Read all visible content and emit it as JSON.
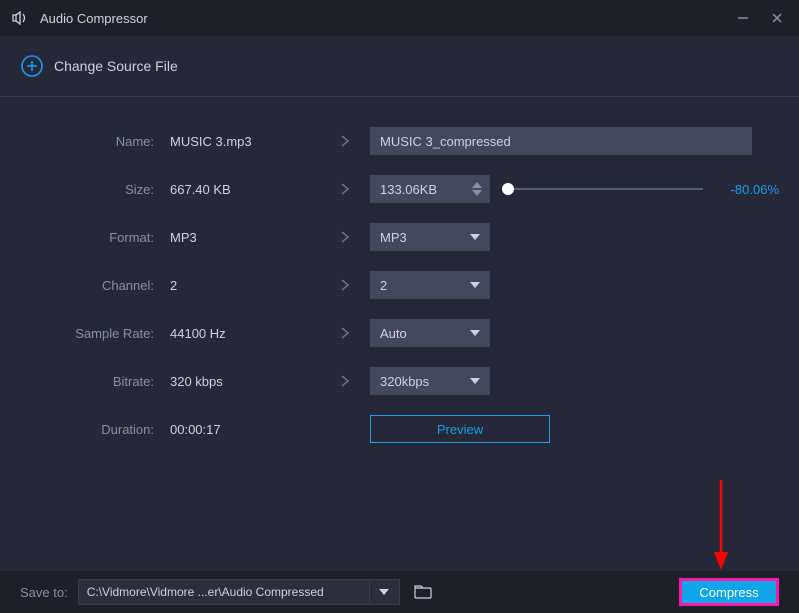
{
  "title": "Audio Compressor",
  "topbar": {
    "change_source_label": "Change Source File"
  },
  "labels": {
    "name": "Name:",
    "size": "Size:",
    "format": "Format:",
    "channel": "Channel:",
    "sample_rate": "Sample Rate:",
    "bitrate": "Bitrate:",
    "duration": "Duration:"
  },
  "source": {
    "name": "MUSIC 3.mp3",
    "size": "667.40 KB",
    "format": "MP3",
    "channel": "2",
    "sample_rate": "44100 Hz",
    "bitrate": "320 kbps",
    "duration": "00:00:17"
  },
  "target": {
    "name": "MUSIC 3_compressed",
    "size": "133.06KB",
    "size_percent": "-80.06%",
    "format": "MP3",
    "channel": "2",
    "sample_rate": "Auto",
    "bitrate": "320kbps"
  },
  "buttons": {
    "preview": "Preview",
    "compress": "Compress"
  },
  "save": {
    "label": "Save to:",
    "path": "C:\\Vidmore\\Vidmore ...er\\Audio Compressed"
  }
}
